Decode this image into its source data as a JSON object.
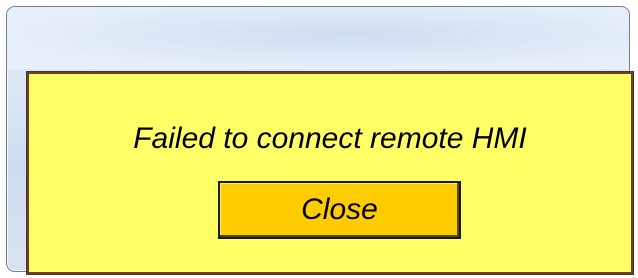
{
  "dialog": {
    "message": "Failed to connect remote HMI",
    "close_label": "Close",
    "background_color": "#ffff66",
    "button_color": "#ffcc00"
  }
}
